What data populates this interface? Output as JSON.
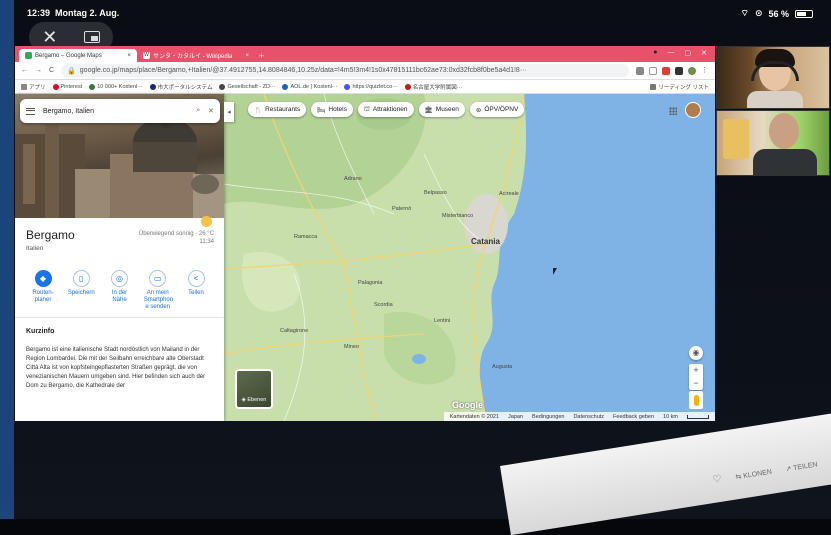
{
  "status": {
    "time": "12:39",
    "date": "Montag 2. Aug.",
    "battery_pct": "56 %"
  },
  "overlay": {
    "close_glyph": "✕"
  },
  "browser": {
    "tabs": [
      {
        "title": "Bergamo – Google Maps",
        "close": "×",
        "favicon_color": "#34a853"
      },
      {
        "title": "サンタ・カタルイ - Wikipedia",
        "close": "×",
        "favicon_color": "#ffffff"
      }
    ],
    "new_tab": "+",
    "window_controls": {
      "minimize": "—",
      "maximize": "▢",
      "close": "✕"
    },
    "nav": {
      "back": "←",
      "forward": "→",
      "reload": "C"
    },
    "url": "google.co.jp/maps/place/Bergamo,+Italien/@37.4912755,14.8084846,10.25z/data=!4m5!3m4!1s0x47815111bc62ae73:0xd32fcb8f0be5a4d1!8···",
    "bookmarks": [
      {
        "label": "アプリ",
        "color": "#888"
      },
      {
        "label": "Pinterest",
        "color": "#e60023"
      },
      {
        "label": "10 000+ Kostenl···",
        "color": "#2e7d32"
      },
      {
        "label": "市大ポータルシステム",
        "color": "#1a237e"
      },
      {
        "label": "Gesellschaft - ZD···",
        "color": "#444"
      },
      {
        "label": "AOL.de | Kostenl···",
        "color": "#1565c0"
      },
      {
        "label": "https://quizlet.co···",
        "color": "#4255ff"
      },
      {
        "label": "名古屋大学附属図···",
        "color": "#b71c1c"
      },
      {
        "label": "リーディング リスト",
        "color": "#777"
      }
    ]
  },
  "maps": {
    "search": {
      "value": "Bergamo, Italien"
    },
    "place": {
      "title": "Bergamo",
      "subtitle": "Italien",
      "weather_text": "Überwiegend sonnig · 26 °C",
      "weather_time": "11:34"
    },
    "actions": [
      {
        "label": "Routen- planer",
        "glyph": "◆"
      },
      {
        "label": "Speichern",
        "glyph": "▯"
      },
      {
        "label": "In der Nähe",
        "glyph": "◎"
      },
      {
        "label": "An mein Smartphon e senden",
        "glyph": "▭"
      },
      {
        "label": "Teilen",
        "glyph": "<"
      }
    ],
    "kurzinfo": {
      "heading": "Kurzinfo",
      "text": "Bergamo ist eine italienische Stadt nordöstlich von Mailand in der Region Lombardei. Die mit der Seilbahn erreichbare alte Oberstadt Città Alta ist von kopfsteingepflasterten Straßen geprägt, die von venezianischen Mauern umgeben sind. Hier befinden sich auch der Dom zu Bergamo, die Kathedrale der"
    },
    "chips": [
      {
        "label": "Restaurants",
        "glyph": "🍴"
      },
      {
        "label": "Hotels",
        "glyph": "🛏"
      },
      {
        "label": "Attraktionen",
        "glyph": "⛫"
      },
      {
        "label": "Museen",
        "glyph": "🏛"
      },
      {
        "label": "ÖPV/ÖPNV",
        "glyph": "⊜"
      }
    ],
    "map_labels": {
      "city": "Catania",
      "aci": "Acireale",
      "paterno": "Paternò",
      "adrano": "Adrano",
      "belpasso": "Belpasso",
      "caltagirone": "Caltagirone",
      "palagonia": "Palagonia",
      "lentini": "Lentini",
      "augusta": "Augusta",
      "misterbianco": "Misterbianco",
      "ramacca": "Ramacca",
      "mineo": "Mineo",
      "scordia": "Scordia"
    },
    "layer_label": "Ebenen",
    "zoom_in": "+",
    "zoom_out": "−",
    "google_logo": "Google",
    "footer": [
      "Kartendaten © 2021",
      "Japan",
      "Bedingungen",
      "Datenschutz",
      "Feedback geben",
      "10 km"
    ]
  },
  "floor_bar": {
    "like": "♡",
    "clone": "KLONEN",
    "share": "TEILEN"
  }
}
